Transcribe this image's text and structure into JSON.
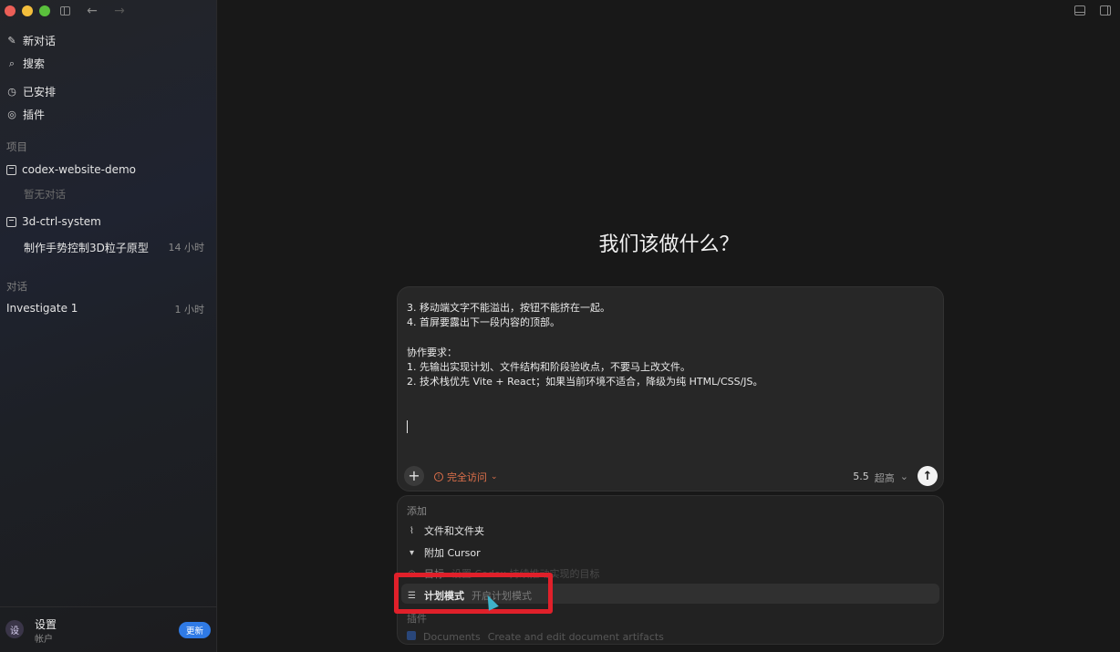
{
  "sidebar": {
    "nav": [
      {
        "label": "新对话",
        "icon": "edit-icon"
      },
      {
        "label": "搜索",
        "icon": "search-icon"
      },
      {
        "label": "已安排",
        "icon": "clock-icon"
      },
      {
        "label": "插件",
        "icon": "plugin-icon"
      }
    ],
    "projects_label": "项目",
    "projects": [
      {
        "name": "codex-website-demo",
        "empty_text": "暂无对话"
      },
      {
        "name": "3d-ctrl-system",
        "thread": {
          "title": "制作手势控制3D粒子原型",
          "time": "14 小时"
        }
      }
    ],
    "conversations_label": "对话",
    "conversations": [
      {
        "title": "Investigate 1",
        "time": "1 小时"
      }
    ],
    "footer": {
      "avatar_text": "设",
      "title": "设置",
      "subtitle": "帐户",
      "badge": "更新"
    }
  },
  "main": {
    "headline": "我们该做什么？",
    "composer": {
      "lines": [
        "3. 移动端文字不能溢出，按钮不能挤在一起。",
        "4. 首屏要露出下一段内容的顶部。",
        "",
        "协作要求：",
        "1. 先输出实现计划、文件结构和阶段验收点，不要马上改文件。",
        "2. 技术栈优先 Vite + React；如果当前环境不适合，降级为纯 HTML/CSS/JS。"
      ],
      "access_label": "完全访问",
      "model": "5.5",
      "level": "超高"
    },
    "menu": {
      "header": "添加",
      "items": [
        {
          "label": "文件和文件夹",
          "desc": ""
        },
        {
          "label": "附加 Cursor",
          "desc": ""
        },
        {
          "label": "目标",
          "desc": "设置 Codex 持续推动实现的目标"
        },
        {
          "label": "计划模式",
          "desc": "开启计划模式"
        }
      ],
      "header2": "插件",
      "last": {
        "label": "Documents",
        "desc": "Create and edit document artifacts"
      }
    }
  },
  "colors": {
    "accent_red": "#e0202a",
    "access_orange": "#e0714b",
    "badge_blue": "#2f7ae5"
  }
}
